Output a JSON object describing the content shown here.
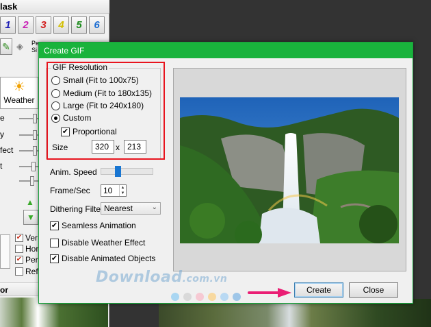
{
  "background_app": {
    "panel_header": "lask",
    "palette_numbers": [
      "1",
      "2",
      "3",
      "4",
      "5",
      "6"
    ],
    "palette_colors": [
      "#1c1cb4",
      "#c81eb4",
      "#d21e1e",
      "#d2be00",
      "#1e8c1e",
      "#1e6ed2"
    ],
    "tool_label_lines": [
      "Pe",
      "Si"
    ],
    "weather_tab": "Weather",
    "slider_labels": [
      "e",
      "y",
      "fect",
      "t",
      ""
    ],
    "checks": [
      {
        "label": "Ver",
        "checked": true
      },
      {
        "label": "Hor",
        "checked": false
      },
      {
        "label": "Pers",
        "checked": true
      },
      {
        "label": "Ref",
        "checked": false
      }
    ],
    "footer_label": "or"
  },
  "dialog": {
    "title": "Create GIF",
    "resolution": {
      "legend": "GIF Resolution",
      "options": [
        {
          "label": "Small (Fit to 100x75)",
          "selected": false
        },
        {
          "label": "Medium (Fit to 180x135)",
          "selected": false
        },
        {
          "label": "Large (Fit to 240x180)",
          "selected": false
        },
        {
          "label": "Custom",
          "selected": true
        }
      ],
      "proportional_label": "Proportional",
      "proportional_checked": true,
      "size_label": "Size",
      "width": "320",
      "separator": "x",
      "height": "213"
    },
    "anim_speed_label": "Anim. Speed",
    "anim_speed_level": 0.3,
    "frame_sec_label": "Frame/Sec",
    "frame_sec_value": "10",
    "dithering_label": "Dithering Filter",
    "dithering_value": "Nearest",
    "options": [
      {
        "label": "Seamless Animation",
        "checked": true
      },
      {
        "label": "Disable Weather Effect",
        "checked": false
      },
      {
        "label": "Disable Animated Objects",
        "checked": true
      }
    ],
    "create_label": "Create",
    "close_label": "Close"
  },
  "watermark": {
    "text": "Download",
    "suffix": ".com.vn",
    "dot_colors": [
      "#a9d6f2",
      "#d9d9d9",
      "#f6c9d3",
      "#f8d9a0",
      "#b9d9f3",
      "#9ec6e8"
    ]
  }
}
